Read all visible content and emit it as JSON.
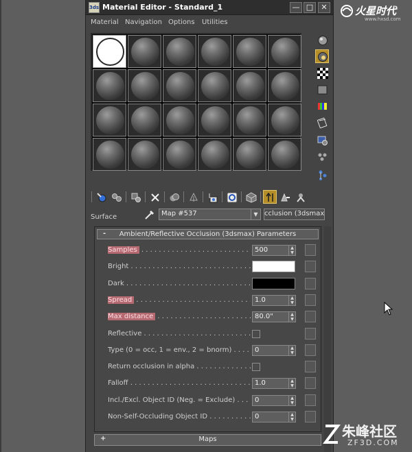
{
  "window": {
    "title": "Material Editor - Standard_1",
    "icon_label": "3ds",
    "minimize_glyph": "—",
    "maximize_glyph": "□",
    "close_glyph": "✕"
  },
  "menu": [
    "Material",
    "Navigation",
    "Options",
    "Utilities"
  ],
  "slots": {
    "rows": 4,
    "cols": 6,
    "active_index": 0
  },
  "side_tools": [
    {
      "icon": "sample-type-sphere-icon"
    },
    {
      "icon": "backlight-icon",
      "active": true
    },
    {
      "icon": "background-checker-icon"
    },
    {
      "icon": "sample-uv-tiling-icon"
    },
    {
      "icon": "video-color-check-icon"
    },
    {
      "icon": "make-preview-icon"
    },
    {
      "icon": "options-icon"
    },
    {
      "icon": "select-by-material-icon"
    },
    {
      "icon": "material-map-navigator-icon"
    }
  ],
  "toolbar": [
    {
      "icon": "get-material-icon"
    },
    {
      "icon": "put-to-scene-icon"
    },
    {
      "icon": "assign-to-selection-icon"
    },
    {
      "icon": "reset-map-icon"
    },
    {
      "icon": "make-copy-icon"
    },
    {
      "icon": "make-unique-icon"
    },
    {
      "icon": "put-to-library-icon"
    },
    {
      "icon": "material-id-channel-icon"
    },
    {
      "icon": "show-map-in-viewport-icon"
    },
    {
      "icon": "show-end-result-icon",
      "active": true
    },
    {
      "icon": "go-to-parent-icon"
    },
    {
      "icon": "go-forward-to-sibling-icon"
    }
  ],
  "surface": {
    "label": "Surface",
    "map_name": "Map #537",
    "map_type": "cclusion (3dsmax)"
  },
  "rollout": {
    "sign": "-",
    "title": "Ambient/Reflective Occlusion (3dsmax) Parameters",
    "params": [
      {
        "label": "Samples",
        "dots": " . . . . . . . . . . . . . . . . . . . . . . . . . . . . . . .",
        "kind": "spinner",
        "value": "500",
        "highlight": true
      },
      {
        "label": "Bright",
        "dots": " . . . . . . . . . . . . . . . . . . . . . . . . . . . . . . . .",
        "kind": "swatch",
        "color": "#ffffff",
        "highlight": false
      },
      {
        "label": "Dark",
        "dots": " . . . . . . . . . . . . . . . . . . . . . . . . . . . . . . . . . .",
        "kind": "swatch",
        "color": "#000000",
        "highlight": false
      },
      {
        "label": "Spread",
        "dots": " . . . . . . . . . . . . . . . . . . . . . . . . . . . . . . .",
        "kind": "spinner",
        "value": "1.0",
        "highlight": true
      },
      {
        "label": "Max distance",
        "dots": " . . . . . . . . . . . . . . . . . . . . . . . . . . .",
        "kind": "spinner",
        "value": "80.0\"",
        "highlight": true
      },
      {
        "label": "Reflective",
        "dots": " . . . . . . . . . . . . . . . . . . . . . . . . . . . . . . .",
        "kind": "checkbox",
        "highlight": false
      },
      {
        "label": "Type (0 = occ, 1 = env., 2 = bnorm)",
        "dots": " . . . . . . . . .",
        "kind": "spinner",
        "value": "0",
        "highlight": false
      },
      {
        "label": "Return occlusion in alpha",
        "dots": " . . . . . . . . . . . . . . . . . .",
        "kind": "checkbox",
        "highlight": false
      },
      {
        "label": "Falloff",
        "dots": " . . . . . . . . . . . . . . . . . . . . . . . . . . . . . . . . .",
        "kind": "spinner",
        "value": "1.0",
        "highlight": false
      },
      {
        "label": "Incl./Excl. Object ID (Neg. = Exclude)",
        "dots": " . . . . . . .",
        "kind": "spinner",
        "value": "0",
        "highlight": false
      },
      {
        "label": "Non-Self-Occluding Object ID",
        "dots": " . . . . . . . . . . . . . . . .",
        "kind": "spinner",
        "value": "0",
        "highlight": false
      }
    ]
  },
  "maps_rollout": {
    "sign": "+",
    "title": "Maps"
  },
  "watermark_top": {
    "main": "火星时代",
    "sub": "www.hxsd.com"
  },
  "watermark_bottom": {
    "main": "朱峰社区",
    "sub": "ZF3D.COM"
  },
  "colors": {
    "highlight": "#b56a72",
    "active_tool": "#b58e2a",
    "panel_bg": "#444444"
  }
}
